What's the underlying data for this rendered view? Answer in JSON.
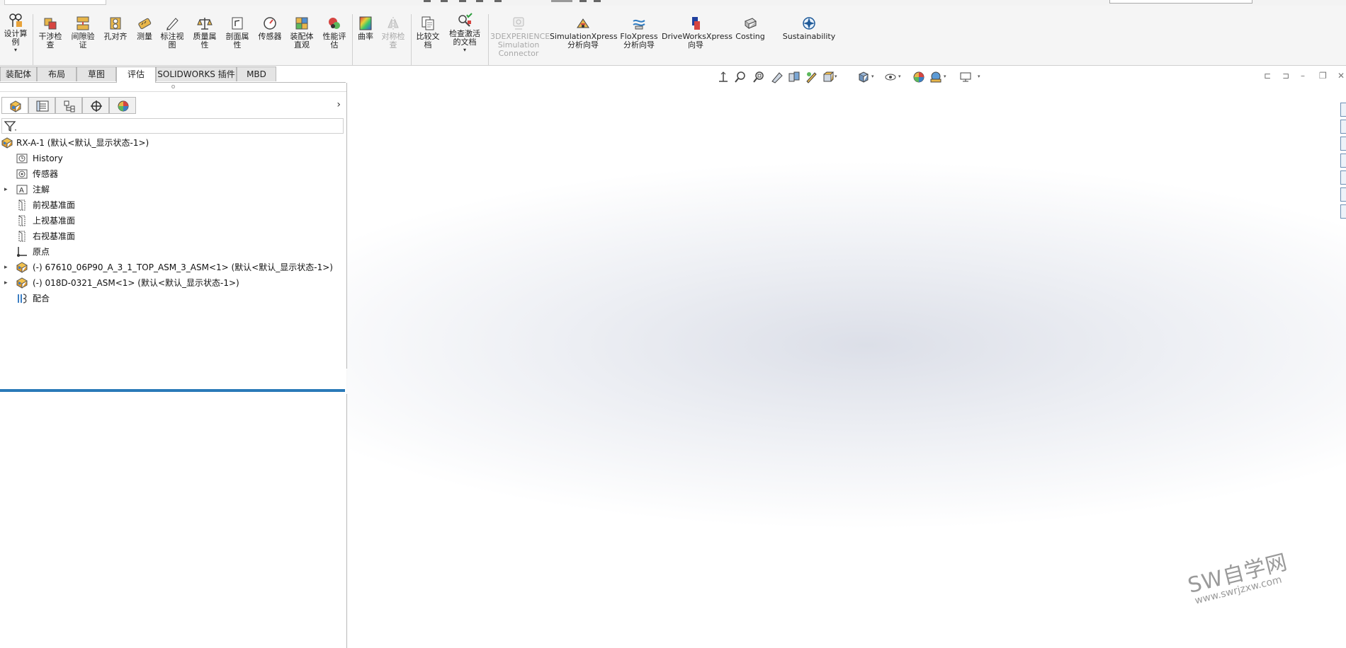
{
  "commandbar": {
    "tools": [
      {
        "id": "design-study",
        "label1": "设计算",
        "label2": "例",
        "dropdown": true,
        "disabled": false
      },
      {
        "id": "interference-check",
        "label1": "干涉检",
        "label2": "查",
        "disabled": false
      },
      {
        "id": "clearance-verification",
        "label1": "间隙验",
        "label2": "证",
        "disabled": false
      },
      {
        "id": "hole-alignment",
        "label1": "孔对齐",
        "label2": "",
        "disabled": false
      },
      {
        "id": "measure",
        "label1": "测量",
        "label2": "",
        "disabled": false
      },
      {
        "id": "markup",
        "label1": "标注视",
        "label2": "图",
        "disabled": false
      },
      {
        "id": "mass-properties",
        "label1": "质量属",
        "label2": "性",
        "disabled": false
      },
      {
        "id": "section-properties",
        "label1": "剖面属",
        "label2": "性",
        "disabled": false
      },
      {
        "id": "sensor",
        "label1": "传感器",
        "label2": "",
        "disabled": false
      },
      {
        "id": "assembly-visualization",
        "label1": "装配体",
        "label2": "直观",
        "disabled": false
      },
      {
        "id": "performance-evaluation",
        "label1": "性能评",
        "label2": "估",
        "disabled": false
      },
      {
        "id": "curvature",
        "label1": "曲率",
        "label2": "",
        "disabled": false
      },
      {
        "id": "symmetry-check",
        "label1": "对称检",
        "label2": "查",
        "disabled": true
      },
      {
        "id": "compare-documents",
        "label1": "比较文",
        "label2": "档",
        "disabled": false
      },
      {
        "id": "check-active-document",
        "label1": "检查激活",
        "label2": "的文档",
        "dropdown": true,
        "disabled": false
      },
      {
        "id": "3dexperience",
        "label1": "3DEXPERIENCE",
        "label2": "Simulation",
        "label3": "Connector",
        "disabled": true
      },
      {
        "id": "simulationxpress",
        "label1": "SimulationXpress",
        "label2": "分析向导",
        "disabled": false
      },
      {
        "id": "floxpress",
        "label1": "FloXpress",
        "label2": "分析向导",
        "disabled": false
      },
      {
        "id": "driveworksxpress",
        "label1": "DriveWorksXpress",
        "label2": "向导",
        "disabled": false
      },
      {
        "id": "costing",
        "label1": "Costing",
        "label2": "",
        "disabled": false
      },
      {
        "id": "sustainability",
        "label1": "Sustainability",
        "label2": "",
        "disabled": false
      }
    ]
  },
  "tabs": [
    {
      "label": "装配体",
      "active": false
    },
    {
      "label": "布局",
      "active": false
    },
    {
      "label": "草图",
      "active": false
    },
    {
      "label": "评估",
      "active": true
    },
    {
      "label": "SOLIDWORKS 插件",
      "active": false
    },
    {
      "label": "MBD",
      "active": false
    }
  ],
  "manager_tabs": [
    "featuremanager",
    "propertymanager",
    "configurationmanager",
    "dimxpertmanager",
    "displaymanager"
  ],
  "tree": {
    "root": "RX-A-1  (默认<默认_显示状态-1>)",
    "items": [
      {
        "label": "History",
        "icon": "history-icon",
        "expand": false
      },
      {
        "label": "传感器",
        "icon": "sensor-icon",
        "expand": false
      },
      {
        "label": "注解",
        "icon": "annotation-icon",
        "expand": true
      },
      {
        "label": "前视基准面",
        "icon": "plane-icon",
        "expand": false
      },
      {
        "label": "上视基准面",
        "icon": "plane-icon",
        "expand": false
      },
      {
        "label": "右视基准面",
        "icon": "plane-icon",
        "expand": false
      },
      {
        "label": "原点",
        "icon": "origin-icon",
        "expand": false
      },
      {
        "label": "(-) 67610_06P90_A_3_1_TOP_ASM_3_ASM<1> (默认<默认_显示状态-1>)",
        "icon": "assembly-icon",
        "expand": true
      },
      {
        "label": "(-) 018D-0321_ASM<1> (默认<默认_显示状态-1>)",
        "icon": "assembly-icon",
        "expand": true
      },
      {
        "label": "配合",
        "icon": "mates-icon",
        "expand": false
      }
    ]
  },
  "heads_up_toolbar": [
    "view-orientation-icon",
    "zoom-to-fit-icon",
    "zoom-to-area-icon",
    "previous-view-icon",
    "section-view-icon",
    "dynamic-annotation-icon",
    "view-selector-icon",
    "display-style-icon",
    "hide-show-icon",
    "edit-appearance-icon",
    "apply-scene-icon",
    "view-settings-icon"
  ],
  "watermark": {
    "line1": "SW自学网",
    "line2": "www.swrjzxw.com"
  },
  "colors": {
    "accent": "#2a7ab8",
    "toolbar_bg": "#f5f5f5",
    "viewport_center": "#dcdfe8"
  }
}
